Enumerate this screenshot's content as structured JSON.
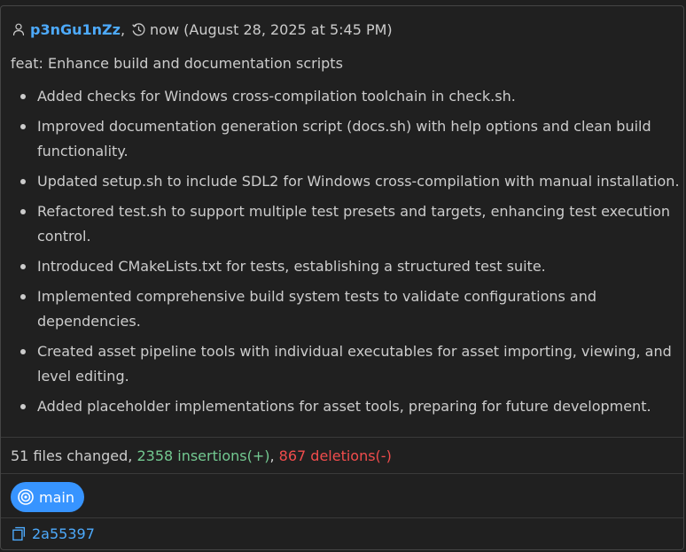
{
  "commit": {
    "author": "p3nGu1nZz",
    "author_separator": ",",
    "time": "now (August 28, 2025 at 5:45 PM)",
    "title": "feat: Enhance build and documentation scripts",
    "changes": [
      "Added checks for Windows cross-compilation toolchain in check.sh.",
      "Improved documentation generation script (docs.sh) with help options and clean build functionality.",
      "Updated setup.sh to include SDL2 for Windows cross-compilation with manual installation.",
      "Refactored test.sh to support multiple test presets and targets, enhancing test execution control.",
      "Introduced CMakeLists.txt for tests, establishing a structured test suite.",
      "Implemented comprehensive build system tests to validate configurations and dependencies.",
      "Created asset pipeline tools with individual executables for asset importing, viewing, and level editing.",
      "Added placeholder implementations for asset tools, preparing for future development."
    ],
    "stats": {
      "files_changed": "51 files changed",
      "sep1": ", ",
      "insertions": "2358 insertions(+)",
      "sep2": ", ",
      "deletions": "867 deletions(-)"
    },
    "branch": "main",
    "hash": "2a55397"
  },
  "icons": {
    "author": "person-icon",
    "time": "history-icon",
    "branch": "target-icon",
    "hash": "copy-icon"
  },
  "colors": {
    "background": "#202020",
    "text": "#cccccc",
    "link": "#4daafc",
    "insertions": "#73c991",
    "deletions": "#f14c4c",
    "branch_badge": "#3794ff"
  }
}
